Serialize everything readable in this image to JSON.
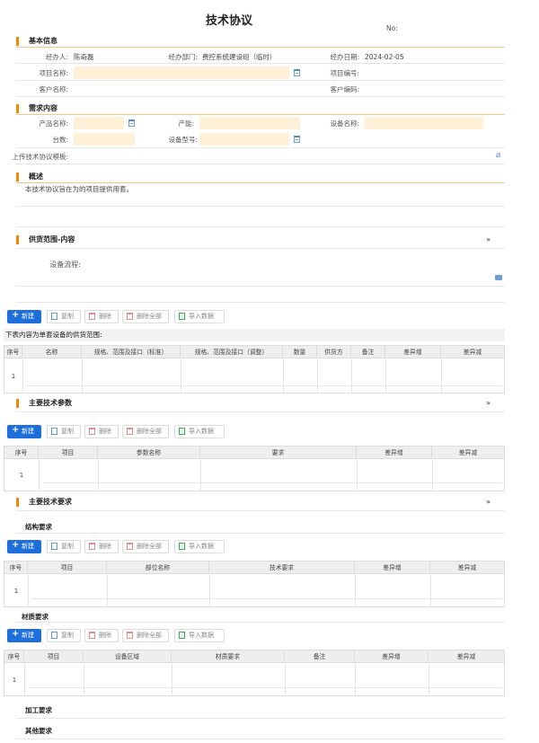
{
  "page": {
    "title": "技术协议",
    "no_label": "No:"
  },
  "basic": {
    "section": "基本信息",
    "handler_label": "经办人:",
    "handler_value": "陈奇磊",
    "dept_label": "经办部门:",
    "dept_value": "费控系统建设组（临时）",
    "date_label": "经办日期:",
    "date_value": "2024-02-05",
    "project_name_label": "项目名称:",
    "project_code_label": "项目编号:",
    "customer_name_label": "客户名称:",
    "customer_code_label": "客户编码:"
  },
  "demand": {
    "section": "需求内容",
    "product_label": "产品名称:",
    "capacity_label": "产能:",
    "equipment_label": "设备名称:",
    "count_label": "台数:",
    "model_label": "设备型号:",
    "upload_label": "上传技术协议模板:"
  },
  "overview": {
    "section": "概述",
    "text": "本技术协议旨在为的项目提供用套。"
  },
  "toolbar": {
    "new": "新建",
    "copy": "复制",
    "delete": "删除",
    "delete_all": "删除全部",
    "import": "导入数据"
  },
  "supply": {
    "section": "供货范围-内容",
    "flow_label": "设备流程:",
    "caption": "下表内容为单套设备的供货范围:",
    "columns": [
      "序号",
      "名称",
      "规格、范围及接口（标准）",
      "规格、范围及接口（调整）",
      "数量",
      "供货方",
      "备注",
      "差异增",
      "差异减"
    ],
    "row_no": "1"
  },
  "params": {
    "section": "主要技术参数",
    "columns": [
      "序号",
      "项目",
      "参数名称",
      "要求",
      "差异增",
      "差异减"
    ],
    "row_no": "1"
  },
  "requirements": {
    "section": "主要技术要求",
    "structure": {
      "label": "结构要求",
      "columns": [
        "序号",
        "项目",
        "部位名称",
        "技术要求",
        "差异增",
        "差异减"
      ],
      "row_no": "1"
    },
    "material": {
      "label": "材质要求",
      "columns": [
        "序号",
        "项目",
        "设备区域",
        "材质要求",
        "备注",
        "差异增",
        "差异减"
      ],
      "row_no": "1"
    },
    "processing_label": "加工要求",
    "other_label": "其他要求"
  },
  "icons": {
    "collapse": "chevron-double-down-icon",
    "calendar": "calendar-icon",
    "attach": "paperclip-icon",
    "image": "image-icon"
  },
  "colors": {
    "accent": "#f08a00",
    "primary": "#1e6fd9",
    "input_bg": "#fff1d8",
    "header_bg": "#eeeeee"
  }
}
